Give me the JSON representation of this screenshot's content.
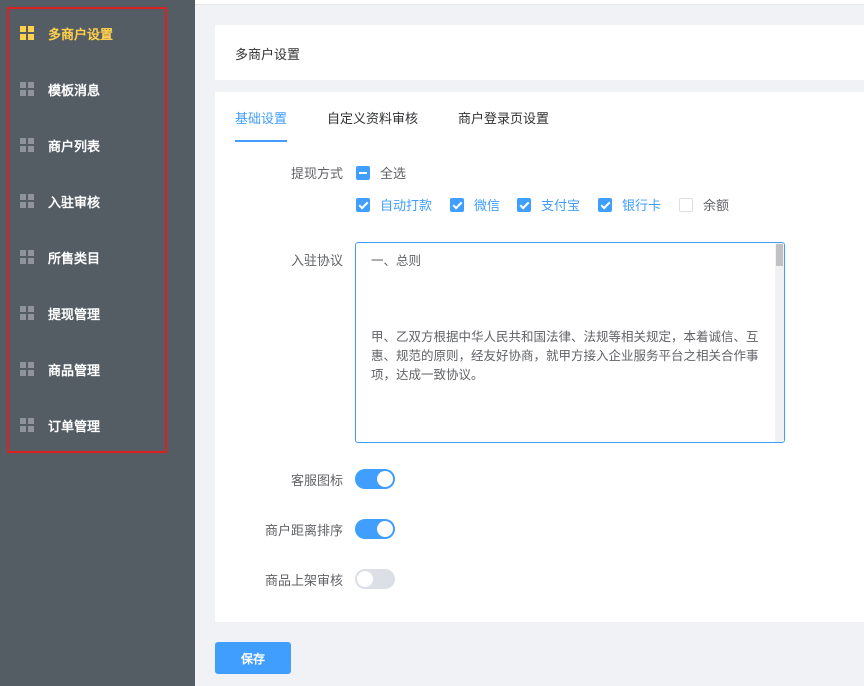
{
  "sidebar": {
    "items": [
      {
        "label": "多商户设置",
        "icon": "grid-icon",
        "active": true
      },
      {
        "label": "模板消息",
        "icon": "grid-icon"
      },
      {
        "label": "商户列表",
        "icon": "grid-icon"
      },
      {
        "label": "入驻审核",
        "icon": "grid-icon"
      },
      {
        "label": "所售类目",
        "icon": "grid-icon"
      },
      {
        "label": "提现管理",
        "icon": "grid-icon"
      },
      {
        "label": "商品管理",
        "icon": "grid-icon"
      },
      {
        "label": "订单管理",
        "icon": "grid-icon"
      }
    ]
  },
  "header": {
    "title": "多商户设置"
  },
  "tabs": [
    {
      "label": "基础设置",
      "active": true
    },
    {
      "label": "自定义资料审核"
    },
    {
      "label": "商户登录页设置"
    }
  ],
  "form": {
    "withdraw": {
      "label": "提现方式",
      "select_all": "全选",
      "options": [
        {
          "label": "自动打款",
          "checked": true
        },
        {
          "label": "微信",
          "checked": true
        },
        {
          "label": "支付宝",
          "checked": true
        },
        {
          "label": "银行卡",
          "checked": true
        },
        {
          "label": "余额",
          "checked": false
        }
      ]
    },
    "agreement": {
      "label": "入驻协议",
      "text": "一、总则\n\n\n\n甲、乙双方根据中华人民共和国法律、法规等相关规定，本着诚信、互惠、规范的原则，经友好协商，就甲方接入企业服务平台之相关合作事项，达成一致协议。\n\n\n\n\n二、平台特别说明：甲以企业向本协议之约定"
    },
    "service_icon": {
      "label": "客服图标",
      "on": true
    },
    "distance_sort": {
      "label": "商户距离排序",
      "on": true
    },
    "goods_review": {
      "label": "商品上架审核",
      "on": false
    }
  },
  "save_label": "保存",
  "colors": {
    "accent": "#409eff",
    "sidebar_bg": "#545c64",
    "active_text": "#ffd04b",
    "highlight": "#e02020"
  }
}
